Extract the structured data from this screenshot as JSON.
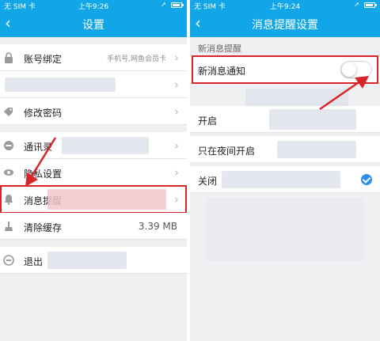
{
  "left": {
    "status": {
      "carrier": "无 SIM 卡",
      "time": "上午9:26"
    },
    "navbar": {
      "back": "‹",
      "title": "设置"
    },
    "rows": [
      {
        "label": "账号绑定",
        "hint": "手机号,网鱼会员卡"
      },
      {
        "label": ""
      },
      {
        "label": "修改密码"
      },
      {
        "label": "通讯录"
      },
      {
        "label": "隐私设置"
      },
      {
        "label": "消息提醒"
      },
      {
        "label": "清除缓存",
        "size": "3.39 MB"
      },
      {
        "label": "退出"
      }
    ],
    "chevron": "›"
  },
  "right": {
    "status": {
      "carrier": "无 SIM 卡",
      "time": "上午9:24"
    },
    "navbar": {
      "back": "‹",
      "title": "消息提醒设置"
    },
    "section_title": "新消息提醒",
    "notify_row": {
      "label": "新消息通知",
      "enabled": false
    },
    "options": [
      {
        "label": "开启",
        "selected": false
      },
      {
        "label": "只在夜间开启",
        "selected": false
      },
      {
        "label": "关闭",
        "selected": true
      }
    ]
  },
  "colors": {
    "header": "#10a6e7",
    "highlight": "#d8252a",
    "check": "#2d8ff0"
  }
}
